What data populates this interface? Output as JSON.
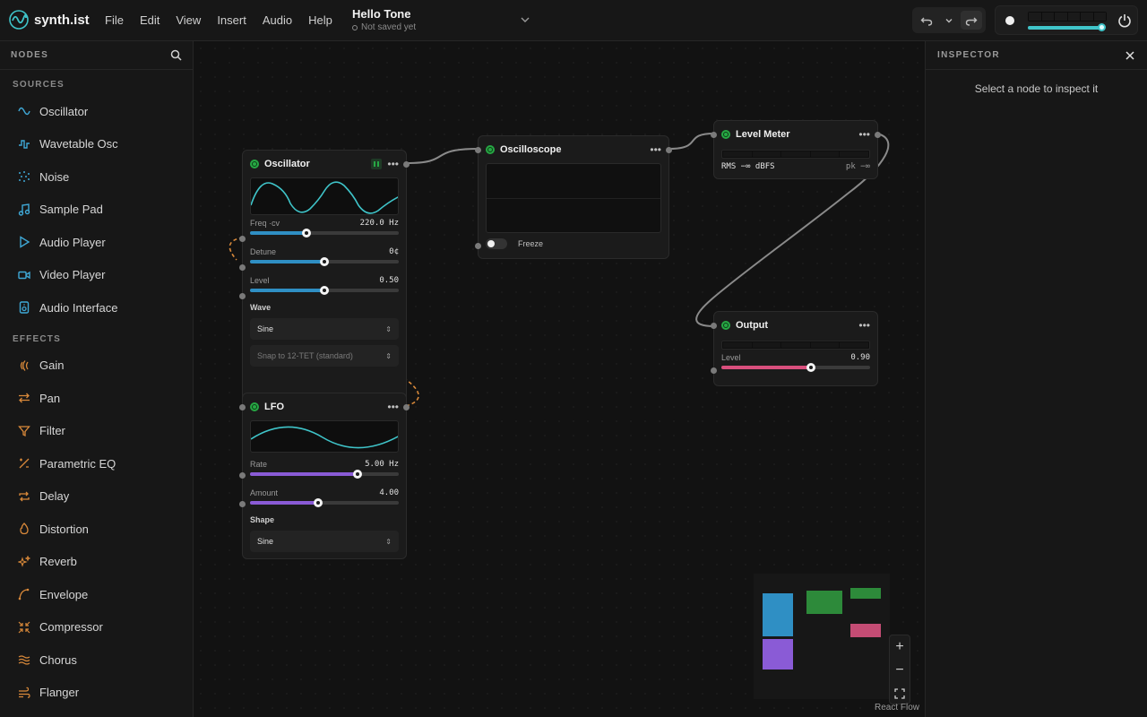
{
  "app": {
    "name": "synth.ist"
  },
  "menu": [
    "File",
    "Edit",
    "View",
    "Insert",
    "Audio",
    "Help"
  ],
  "document": {
    "title": "Hello Tone",
    "status": "Not saved yet"
  },
  "transport": {
    "master_volume": 0.96
  },
  "sidebar": {
    "header": "NODES",
    "sections": [
      {
        "title": "SOURCES",
        "items": [
          {
            "label": "Oscillator",
            "icon": "sine-wave-icon"
          },
          {
            "label": "Wavetable Osc",
            "icon": "wavetable-icon"
          },
          {
            "label": "Noise",
            "icon": "noise-icon"
          },
          {
            "label": "Sample Pad",
            "icon": "music-note-icon"
          },
          {
            "label": "Audio Player",
            "icon": "play-icon"
          },
          {
            "label": "Video Player",
            "icon": "video-icon"
          },
          {
            "label": "Audio Interface",
            "icon": "speaker-icon"
          }
        ]
      },
      {
        "title": "EFFECTS",
        "items": [
          {
            "label": "Gain",
            "icon": "gain-icon"
          },
          {
            "label": "Pan",
            "icon": "pan-arrows-icon"
          },
          {
            "label": "Filter",
            "icon": "filter-funnel-icon"
          },
          {
            "label": "Parametric EQ",
            "icon": "eq-icon"
          },
          {
            "label": "Delay",
            "icon": "delay-repeat-icon"
          },
          {
            "label": "Distortion",
            "icon": "flame-icon"
          },
          {
            "label": "Reverb",
            "icon": "sparkle-icon"
          },
          {
            "label": "Envelope",
            "icon": "envelope-curve-icon"
          },
          {
            "label": "Compressor",
            "icon": "compress-icon"
          },
          {
            "label": "Chorus",
            "icon": "waves-icon"
          },
          {
            "label": "Flanger",
            "icon": "flanger-wind-icon"
          }
        ]
      }
    ]
  },
  "nodes": {
    "oscillator": {
      "title": "Oscillator",
      "params": [
        {
          "label": "Freq ·cv",
          "value": "220.0 Hz",
          "fraction": 0.38
        },
        {
          "label": "Detune",
          "value": "0¢",
          "fraction": 0.5
        },
        {
          "label": "Level",
          "value": "0.50",
          "fraction": 0.5
        }
      ],
      "wave_label": "Wave",
      "wave_value": "Sine",
      "tuning_value": "Snap to 12-TET (standard)"
    },
    "lfo": {
      "title": "LFO",
      "params": [
        {
          "label": "Rate",
          "value": "5.00 Hz",
          "fraction": 0.72
        },
        {
          "label": "Amount",
          "value": "4.00",
          "fraction": 0.46
        }
      ],
      "shape_label": "Shape",
      "shape_value": "Sine"
    },
    "oscilloscope": {
      "title": "Oscilloscope",
      "freeze_label": "Freeze"
    },
    "level_meter": {
      "title": "Level Meter",
      "rms": "RMS −∞ dBFS",
      "peak": "pk −∞"
    },
    "output": {
      "title": "Output",
      "level_label": "Level",
      "level_value": "0.90",
      "fraction": 0.6
    }
  },
  "colors": {
    "accent_cyan": "#3fc4c9",
    "osc_blue": "#2f8fc4",
    "lfo_purple": "#8a5bd6",
    "output_pink": "#d94f7d",
    "power_green": "#27a844",
    "cv_wire": "#d9893a"
  },
  "canvas": {
    "credit": "React Flow"
  },
  "inspector": {
    "header": "INSPECTOR",
    "empty_text": "Select a node to inspect it"
  }
}
